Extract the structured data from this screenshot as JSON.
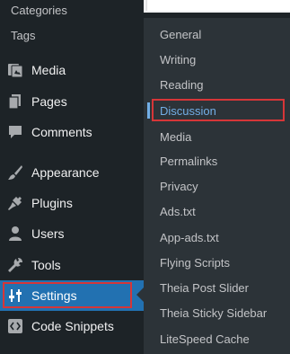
{
  "sidebar": {
    "subitems": [
      "Categories",
      "Tags"
    ],
    "items": [
      {
        "label": "Media",
        "icon": "media-icon"
      },
      {
        "label": "Pages",
        "icon": "pages-icon"
      },
      {
        "label": "Comments",
        "icon": "comments-icon"
      },
      {
        "label": "Appearance",
        "icon": "appearance-icon"
      },
      {
        "label": "Plugins",
        "icon": "plugins-icon"
      },
      {
        "label": "Users",
        "icon": "users-icon"
      },
      {
        "label": "Tools",
        "icon": "tools-icon"
      },
      {
        "label": "Settings",
        "icon": "settings-icon",
        "current": true
      },
      {
        "label": "Code Snippets",
        "icon": "code-snippets-icon"
      }
    ]
  },
  "flyout": {
    "items": [
      "General",
      "Writing",
      "Reading",
      "Discussion",
      "Media",
      "Permalinks",
      "Privacy",
      "Ads.txt",
      "App-ads.txt",
      "Flying Scripts",
      "Theia Post Slider",
      "Theia Sticky Sidebar",
      "LiteSpeed Cache"
    ],
    "active": "Discussion"
  },
  "colors": {
    "sidebar_bg": "#1d2327",
    "flyout_bg": "#2c3338",
    "accent": "#2271b1",
    "active_link": "#72aee6",
    "highlight": "#d63638"
  }
}
